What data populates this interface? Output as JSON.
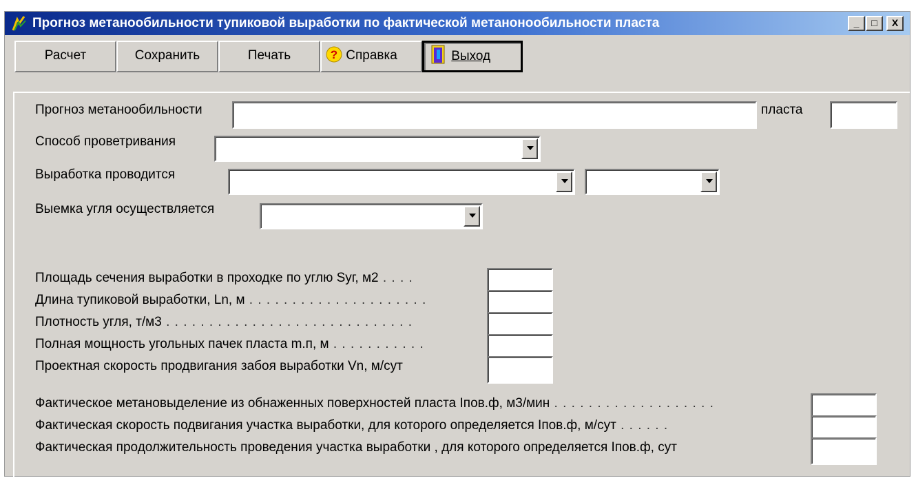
{
  "window": {
    "title": "Прогноз метанообильности тупиковой выработки по фактической метанонообильности пласта",
    "controls": [
      "_",
      "□",
      "X"
    ]
  },
  "toolbar": {
    "calc_label": "Расчет",
    "save_label": "Сохранить",
    "print_label": "Печать",
    "help_label": "Справка",
    "exit_label": "Выход",
    "help_icon": "question-icon",
    "exit_icon": "door-exit-icon"
  },
  "form": {
    "forecast_label": "Прогноз метанообильности",
    "forecast_value": "",
    "seam_label": "пласта",
    "seam_value": "",
    "ventilation_label": "Способ проветривания",
    "ventilation_value": "",
    "working_label": "Выработка проводится",
    "working_value1": "",
    "working_value2": "",
    "extraction_label": "Выемка угля осуществляется",
    "extraction_value": ""
  },
  "params1": [
    {
      "label": "Площадь сечения выработки в проходке по углю Sуг, м2",
      "dots": " . . . .",
      "value": ""
    },
    {
      "label": "Длина тупиковой выработки, Ln, м",
      "dots": " . . . . . . . . . . . . . . . . . . . . .",
      "value": ""
    },
    {
      "label": "Плотность угля, т/м3",
      "dots": "         . . . . . . . . . . . . . . . . . . . . . . . . . . . . .",
      "value": ""
    },
    {
      "label": "Полная мощность угольных пачек пласта m.п, м",
      "dots": " . . . . . . . . . . .",
      "value": ""
    },
    {
      "label": "Проектная скорость продвигания забоя выработки Vn, м/сут",
      "dots": "",
      "value": ""
    }
  ],
  "params2": [
    {
      "label": "Фактическое метановыделение из обнаженных поверхностей пласта Iпов.ф, м3/мин",
      "dots": " . . . . . . . . . . . . . . . . . . .",
      "value": ""
    },
    {
      "label": "Фактическая скорость подвигания участка выработки,  для которого определяется Iпов.ф,  м/сут",
      "dots": "    . . . . . .",
      "value": ""
    },
    {
      "label": "Фактическая продолжительность проведения участка выработки , для которого определяется Iпов.ф, сут",
      "dots": "",
      "value": ""
    }
  ]
}
